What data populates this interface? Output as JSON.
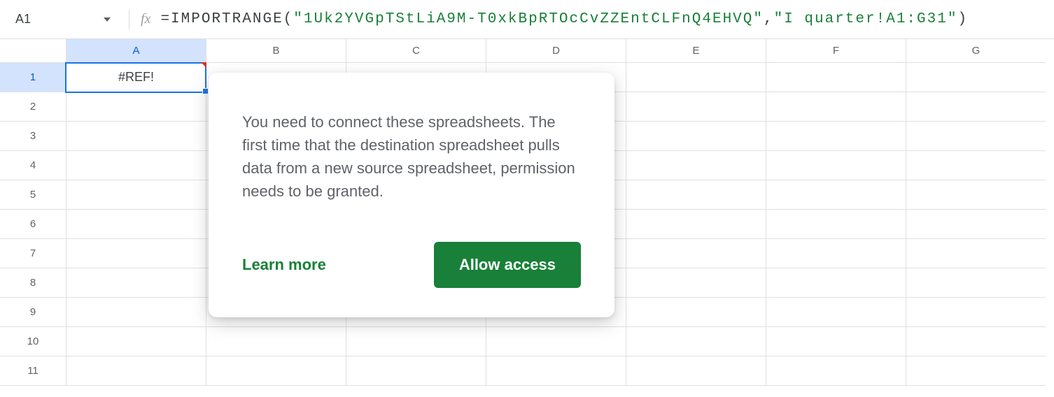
{
  "formula_bar": {
    "name_box": "A1",
    "fx_label": "fx",
    "formula_prefix": "=",
    "formula_fn": "IMPORTRANGE",
    "formula_open": "(",
    "formula_arg1": "\"1Uk2YVGpTStLiA9M-T0xkBpRTOcCvZZEntCLFnQ4EHVQ\"",
    "formula_comma": ",",
    "formula_arg2": "\"I quarter!A1:G31\"",
    "formula_close": ")"
  },
  "columns": [
    "A",
    "B",
    "C",
    "D",
    "E",
    "F",
    "G"
  ],
  "rows": [
    "1",
    "2",
    "3",
    "4",
    "5",
    "6",
    "7",
    "8",
    "9",
    "10",
    "11"
  ],
  "selected_cell": {
    "col": "A",
    "row": "1",
    "value": "#REF!"
  },
  "popover": {
    "message": "You need to connect these spreadsheets. The first time that the destination spreadsheet pulls data from a new source spreadsheet, permission needs to be granted.",
    "learn_more": "Learn more",
    "allow": "Allow access"
  }
}
